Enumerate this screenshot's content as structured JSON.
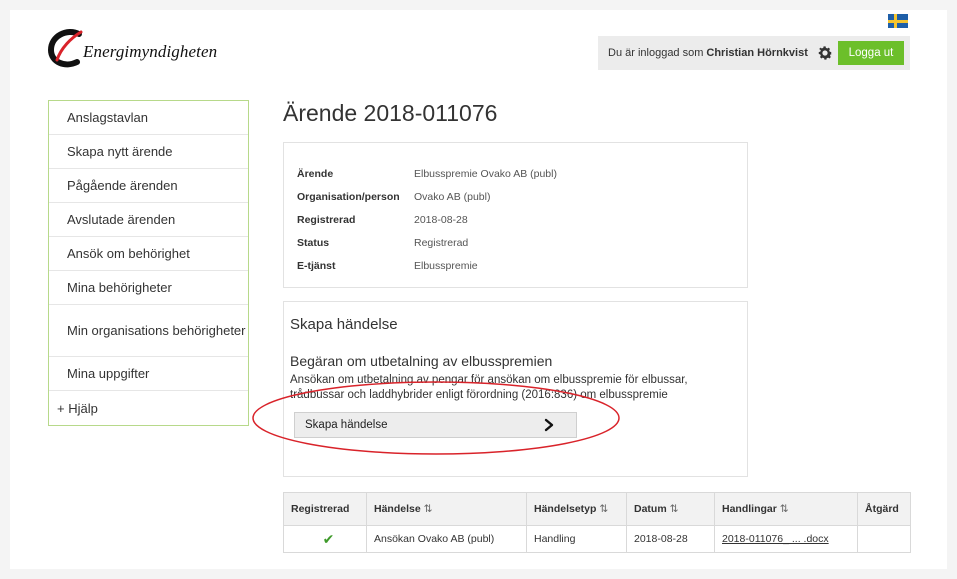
{
  "header": {
    "logo_text": "Energimyndigheten",
    "logged_in_prefix": "Du är inloggad som",
    "user_name": "Christian Hörnkvist",
    "logout_label": "Logga ut"
  },
  "sidebar": {
    "items": [
      {
        "label": "Anslagstavlan"
      },
      {
        "label": "Skapa nytt ärende"
      },
      {
        "label": "Pågående ärenden"
      },
      {
        "label": "Avslutade ärenden"
      },
      {
        "label": "Ansök om behörighet"
      },
      {
        "label": "Mina behörigheter"
      },
      {
        "label": "Min organisations behörigheter"
      },
      {
        "label": "Mina uppgifter"
      },
      {
        "label": "+ Hjälp"
      }
    ]
  },
  "page_title": "Ärende 2018-011076",
  "case_info": {
    "rows": [
      {
        "key": "Ärende",
        "value": "Elbusspremie Ovako AB (publ)"
      },
      {
        "key": "Organisation/person",
        "value": "Ovako AB (publ)"
      },
      {
        "key": "Registrerad",
        "value": "2018-08-28"
      },
      {
        "key": "Status",
        "value": "Registrerad"
      },
      {
        "key": "E-tjänst",
        "value": "Elbusspremie"
      }
    ]
  },
  "create_event": {
    "heading": "Skapa händelse",
    "subheading": "Begäran om utbetalning av elbusspremien",
    "description": "Ansökan om utbetalning av pengar för ansökan om elbusspremie för elbussar, trådbussar och laddhybrider enligt förordning (2016:836) om elbusspremie",
    "button_label": "Skapa händelse"
  },
  "events_table": {
    "headers": {
      "registered": "Registrerad",
      "event": "Händelse",
      "event_type": "Händelsetyp",
      "date": "Datum",
      "documents": "Handlingar",
      "action": "Åtgärd"
    },
    "sort_glyph": "⇅",
    "rows": [
      {
        "registered": "✔",
        "event": "Ansökan Ovako AB (publ)",
        "event_type": "Handling",
        "date": "2018-08-28",
        "documents": "2018-011076_ ... .docx",
        "action": ""
      }
    ]
  },
  "colors": {
    "accent_green": "#6cbf2a",
    "sidebar_border": "#b7d98a",
    "annotation_red": "#d9232a",
    "logo_red": "#d9232a"
  }
}
